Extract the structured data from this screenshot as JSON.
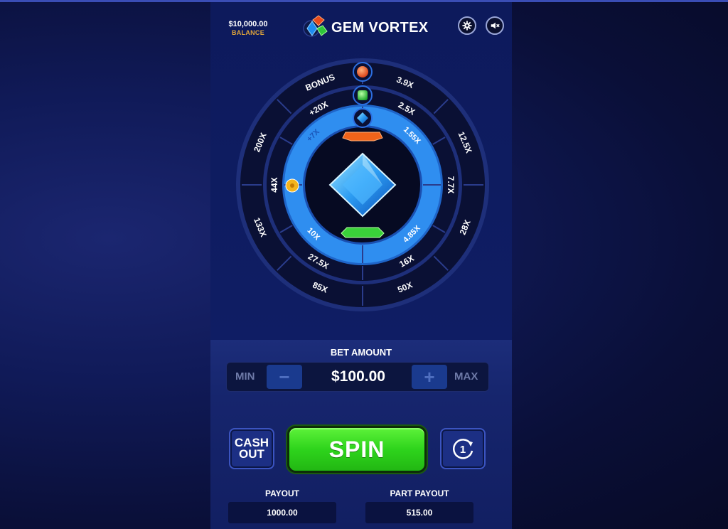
{
  "header": {
    "balance_amount": "$10,000.00",
    "balance_label": "BALANCE",
    "game_title": "GEM VORTEX",
    "settings_icon": "gear-icon",
    "sound_icon": "mute-icon"
  },
  "wheel": {
    "outer_ring": [
      "BONUS",
      "3.9X",
      "12.5X",
      "28X",
      "50X",
      "85X",
      "133X",
      "200X"
    ],
    "middle_ring": [
      "+20X",
      "2.5X",
      "7.7X",
      "16X",
      "27.5X",
      "44X"
    ],
    "inner_ring": [
      "+7X",
      "1.55X",
      "4.85X",
      "10X"
    ],
    "gems": [
      "red-gem",
      "green-gem",
      "blue-gem"
    ],
    "colors": {
      "inner_track": "#2f8ef0",
      "ring_border": "#1e2f7a",
      "ring_fill": "#0a1034"
    }
  },
  "bet": {
    "title": "BET AMOUNT",
    "min_label": "MIN",
    "max_label": "MAX",
    "minus_label": "−",
    "plus_label": "+",
    "amount": "$100.00"
  },
  "actions": {
    "cashout_line1": "CASH",
    "cashout_line2": "OUT",
    "spin_label": "SPIN",
    "autoplay_count": "1"
  },
  "payout": {
    "payout_label": "PAYOUT",
    "payout_value": "1000.00",
    "part_payout_label": "PART PAYOUT",
    "part_payout_value": "515.00"
  }
}
